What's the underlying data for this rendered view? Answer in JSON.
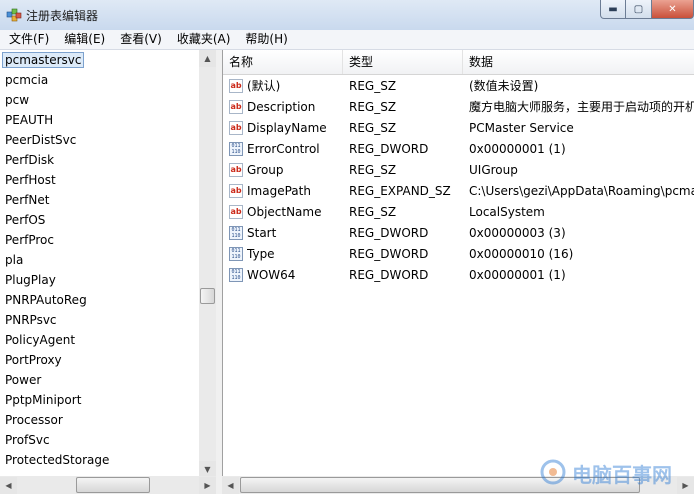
{
  "window": {
    "title": "注册表编辑器",
    "controls": {
      "minimize": "▬",
      "maximize": "▢",
      "close": "✕"
    }
  },
  "menu": [
    "文件(F)",
    "编辑(E)",
    "查看(V)",
    "收藏夹(A)",
    "帮助(H)"
  ],
  "tree": {
    "selected": "pcmastersvc",
    "items": [
      "pcmastersvc",
      "pcmcia",
      "pcw",
      "PEAUTH",
      "PeerDistSvc",
      "PerfDisk",
      "PerfHost",
      "PerfNet",
      "PerfOS",
      "PerfProc",
      "pla",
      "PlugPlay",
      "PNRPAutoReg",
      "PNRPsvc",
      "PolicyAgent",
      "PortProxy",
      "Power",
      "PptpMiniport",
      "Processor",
      "ProfSvc",
      "ProtectedStorage"
    ]
  },
  "list": {
    "columns": {
      "name": "名称",
      "type": "类型",
      "data": "数据"
    },
    "rows": [
      {
        "icon": "string-value-icon",
        "name": "(默认)",
        "type": "REG_SZ",
        "data": "(数值未设置)"
      },
      {
        "icon": "string-value-icon",
        "name": "Description",
        "type": "REG_SZ",
        "data": "魔方电脑大师服务，主要用于启动项的开机"
      },
      {
        "icon": "string-value-icon",
        "name": "DisplayName",
        "type": "REG_SZ",
        "data": "PCMaster Service"
      },
      {
        "icon": "binary-value-icon",
        "name": "ErrorControl",
        "type": "REG_DWORD",
        "data": "0x00000001 (1)"
      },
      {
        "icon": "string-value-icon",
        "name": "Group",
        "type": "REG_SZ",
        "data": "UIGroup"
      },
      {
        "icon": "string-value-icon",
        "name": "ImagePath",
        "type": "REG_EXPAND_SZ",
        "data": "C:\\Users\\gezi\\AppData\\Roaming\\pcma"
      },
      {
        "icon": "string-value-icon",
        "name": "ObjectName",
        "type": "REG_SZ",
        "data": "LocalSystem"
      },
      {
        "icon": "binary-value-icon",
        "name": "Start",
        "type": "REG_DWORD",
        "data": "0x00000003 (3)"
      },
      {
        "icon": "binary-value-icon",
        "name": "Type",
        "type": "REG_DWORD",
        "data": "0x00000010 (16)"
      },
      {
        "icon": "binary-value-icon",
        "name": "WOW64",
        "type": "REG_DWORD",
        "data": "0x00000001 (1)"
      }
    ]
  },
  "icon_glyphs": {
    "string": "ab",
    "binary": "011\n110\n010"
  },
  "watermark": {
    "text": "电脑百事网"
  }
}
